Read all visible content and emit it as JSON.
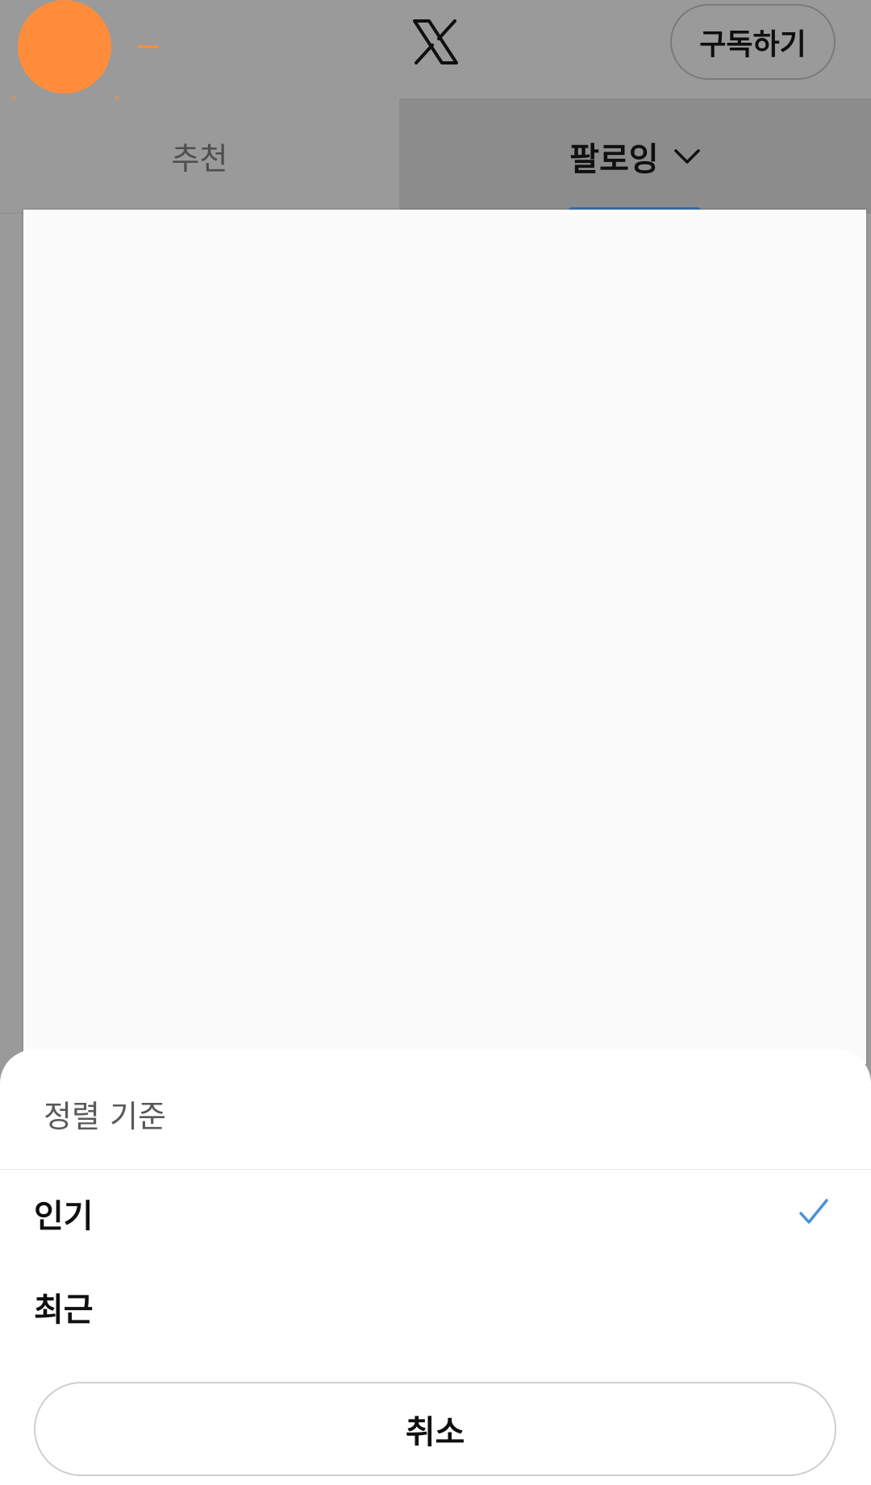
{
  "header": {
    "logo_icon": "x-logo-icon",
    "sun_icon": "sun-icon",
    "subscribe_label": "구독하기"
  },
  "tabs": [
    {
      "label": "추천",
      "selected": false
    },
    {
      "label": "팔로잉",
      "selected": true,
      "icon": "chevron-down-icon"
    }
  ],
  "sort_sheet": {
    "title": "정렬 기준",
    "options": [
      {
        "label": "인기",
        "selected": true,
        "icon": "check-icon"
      },
      {
        "label": "최근",
        "selected": false
      }
    ],
    "cancel_label": "취소"
  },
  "colors": {
    "accent": "#3872ad",
    "check": "#4a90d9",
    "sun": "#ff8c3a",
    "scrim": "#9a9a9a"
  }
}
